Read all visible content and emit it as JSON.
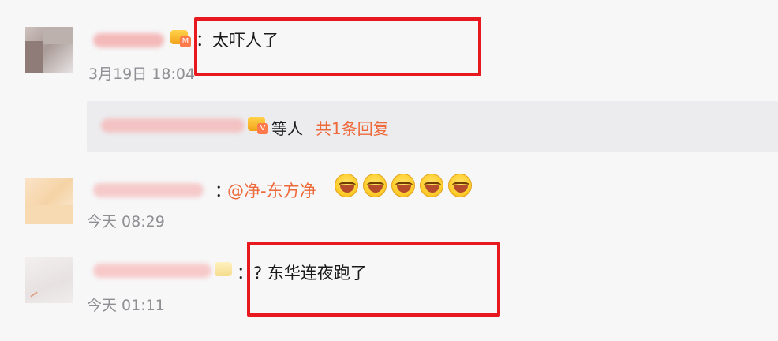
{
  "comments": [
    {
      "text": "：太吓人了",
      "time": "3月19日 18:04"
    },
    {
      "reply_summary": {
        "suffix": "等人",
        "link": "共1条回复"
      }
    },
    {
      "mention": "@净-东方净",
      "time": "今天 08:29",
      "emoji_name": "laugh-cry-emoji",
      "emoji_count": 5
    },
    {
      "text": "：? 东华连夜跑了",
      "time": "今天 01:11"
    }
  ],
  "colors": {
    "highlight": "#e8191e",
    "link": "#ee6a3b",
    "timestamp": "#8e8e93"
  }
}
